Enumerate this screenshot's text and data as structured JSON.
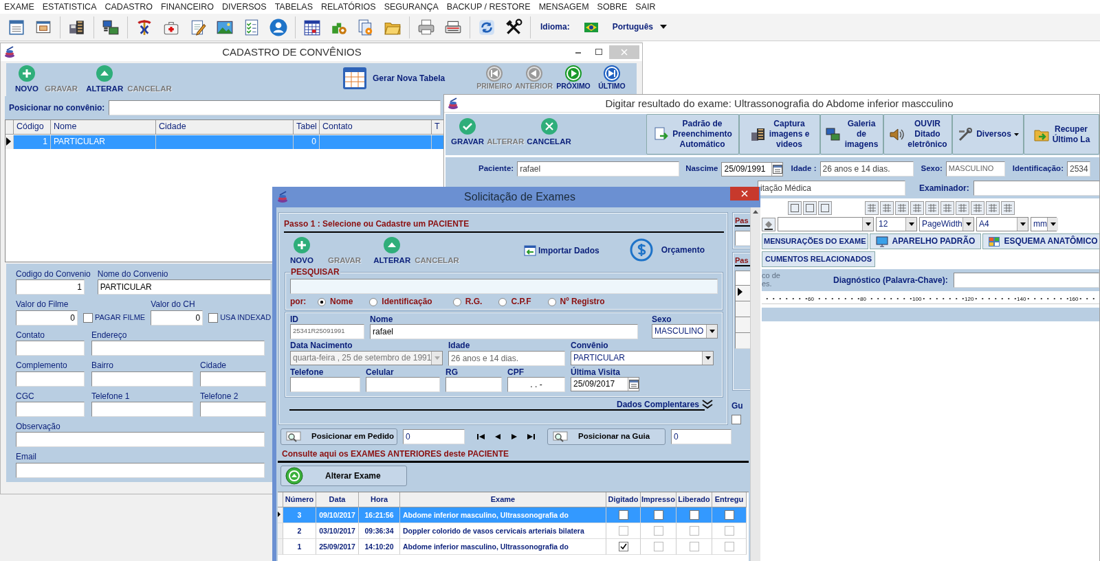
{
  "menu": [
    "EXAME",
    "ESTATISTICA",
    "CADASTRO",
    "FINANCEIRO",
    "DIVERSOS",
    "TABELAS",
    "RELATÓRIOS",
    "SEGURANÇA",
    "BACKUP / RESTORE",
    "MENSAGEM",
    "SOBRE",
    "SAIR"
  ],
  "toolbar": {
    "language_label": "Idioma:",
    "language": "Português"
  },
  "convenios_window": {
    "title": "CADASTRO DE CONVÊNIOS",
    "actions": [
      {
        "kind": "new",
        "label": "NOVO",
        "disabled": false
      },
      {
        "kind": "save",
        "label": "GRAVAR",
        "disabled": true
      },
      {
        "kind": "edit",
        "label": "ALTERAR",
        "disabled": false
      },
      {
        "kind": "cancel",
        "label": "CANCELAR",
        "disabled": true
      }
    ],
    "generate_button": "Gerar Nova Tabela",
    "navigation": [
      {
        "kind": "first",
        "label": "PRIMEIRO",
        "disabled": true
      },
      {
        "kind": "prev",
        "label": "ANTERIOR",
        "disabled": true
      },
      {
        "kind": "next",
        "label": "PRÓXIMO",
        "disabled": false
      },
      {
        "kind": "last",
        "label": "ÚLTIMO",
        "disabled": false
      }
    ],
    "locate_label": "Posicionar no convênio:",
    "table": {
      "columns": [
        "Código",
        "Nome",
        "Cidade",
        "Tabel",
        "Contato",
        "T"
      ],
      "rows": [
        {
          "code": "1",
          "name": "PARTICULAR",
          "table": "0",
          "selected": true
        }
      ]
    },
    "form_rows": [
      [
        {
          "kind": "number",
          "label": "Codigo do Convenio",
          "value": "1"
        },
        {
          "kind": "text",
          "label": "Nome do Convenio",
          "value": "PARTICULAR"
        }
      ],
      [
        {
          "kind": "number",
          "label": "Valor do Filme",
          "value": "0"
        },
        {
          "kind": "checkbox",
          "label": "PAGAR FILME",
          "checked": false
        },
        {
          "kind": "number",
          "label": "Valor do CH",
          "value": "0"
        },
        {
          "kind": "checkbox",
          "label": "USA INDEXAD",
          "checked": false
        }
      ],
      [
        {
          "kind": "text",
          "label": "Contato"
        },
        {
          "kind": "text",
          "label": "Endereço"
        }
      ],
      [
        {
          "kind": "text",
          "label": "Complemento"
        },
        {
          "kind": "text",
          "label": "Bairro"
        },
        {
          "kind": "text",
          "label": "Cidade"
        }
      ],
      [
        {
          "kind": "text",
          "label": "CGC"
        },
        {
          "kind": "text",
          "label": "Telefone 1"
        },
        {
          "kind": "text",
          "label": "Telefone 2"
        }
      ],
      [
        {
          "kind": "text",
          "label": "Observação"
        }
      ],
      [
        {
          "kind": "text",
          "label": "Email"
        }
      ]
    ]
  },
  "result_window": {
    "title": "Digitar resultado do exame: Ultrassonografia do Abdome inferior mascculino",
    "actions": [
      {
        "kind": "save",
        "label": "GRAVAR",
        "disabled": false
      },
      {
        "kind": "edit",
        "label": "ALTERAR",
        "disabled": true
      },
      {
        "kind": "cancel",
        "label": "CANCELAR",
        "disabled": false
      }
    ],
    "tool_buttons": [
      {
        "kind": "template",
        "lines": [
          "Padrão de",
          "Preenchimento",
          "Automático"
        ]
      },
      {
        "kind": "capture",
        "lines": [
          "Captura",
          "imagens e",
          "videos"
        ]
      },
      {
        "kind": "gallery",
        "lines": [
          "Galeria de",
          "imagens"
        ]
      },
      {
        "kind": "dictation",
        "lines": [
          "OUVIR Ditado",
          "eletrônico"
        ]
      },
      {
        "kind": "misc",
        "lines": [
          "Diversos"
        ]
      },
      {
        "kind": "recover",
        "lines": [
          "Recuper",
          "Último La"
        ]
      }
    ],
    "patient_fields": [
      {
        "kind": "text",
        "label": "Paciente:",
        "value": "rafael"
      },
      {
        "kind": "date",
        "label": "Nascime",
        "value": "25/09/1991"
      },
      {
        "kind": "text",
        "label": "Idade :",
        "value": "26 anos e 14 dias."
      },
      {
        "kind": "readonly",
        "label": "Sexo:",
        "value": "MASCULINO"
      },
      {
        "kind": "text",
        "label": "Identificação:",
        "value": "2534"
      }
    ],
    "requester_value": "itação Médica",
    "examiner_label": "Examinador:",
    "format_selects": [
      "12",
      "PageWidth",
      "A4",
      "mm"
    ],
    "tabs": [
      {
        "kind": "measurements",
        "label": "MENSURAÇÕES DO EXAME"
      },
      {
        "kind": "device",
        "label": "APARELHO PADRÃO"
      },
      {
        "kind": "anatomy",
        "label": "ESQUEMA ANATÔMICO"
      }
    ],
    "tabs_second_row": [
      "CUMENTOS RELACIONADOS"
    ],
    "faded_note_lines": [
      "co de",
      "es."
    ],
    "diagnosis_label": "Diagnóstico (Palavra-Chave):",
    "ruler_labels": [
      "60",
      "80",
      "100",
      "120",
      "140",
      "160"
    ]
  },
  "request_window": {
    "title": "Solicitação de Exames",
    "step_title": "Passo 1 : Selecione ou Cadastre um PACIENTE",
    "actions": [
      {
        "kind": "new",
        "label": "NOVO",
        "disabled": false
      },
      {
        "kind": "save",
        "label": "GRAVAR",
        "disabled": true
      },
      {
        "kind": "edit",
        "label": "ALTERAR",
        "disabled": false
      },
      {
        "kind": "cancel",
        "label": "CANCELAR",
        "disabled": true
      }
    ],
    "import_button": "Importar Dados",
    "budget_button": "Orçamento",
    "search_legend": "PESQUISAR",
    "search_by_label": "por:",
    "search_options": [
      {
        "label": "Nome",
        "selected": true
      },
      {
        "label": "Identificação",
        "selected": false
      },
      {
        "label": "R.G.",
        "selected": false
      },
      {
        "label": "C.P.F",
        "selected": false
      },
      {
        "label": "Nº Registro",
        "selected": false
      }
    ],
    "patient_rows": [
      [
        {
          "kind": "readonly",
          "label": "ID",
          "value": "25341R25091991"
        },
        {
          "kind": "text",
          "label": "Nome",
          "value": "rafael"
        },
        {
          "kind": "select",
          "label": "Sexo",
          "value": "MASCULINO"
        }
      ],
      [
        {
          "kind": "disabled_select",
          "label": "Data Nacimento",
          "value": "quarta-feira , 25 de setembro de 1991"
        },
        {
          "kind": "readonly",
          "label": "Idade",
          "value": "26 anos e 14 dias."
        },
        {
          "kind": "select",
          "label": "Convênio",
          "value": "PARTICULAR"
        }
      ],
      [
        {
          "kind": "text",
          "label": "Telefone"
        },
        {
          "kind": "text",
          "label": "Celular"
        },
        {
          "kind": "text",
          "label": "RG"
        },
        {
          "kind": "text",
          "label": "CPF",
          "value": ".  .  -"
        },
        {
          "kind": "date",
          "label": "Última Visita",
          "value": "25/09/2017"
        }
      ]
    ],
    "more_label": "Dados Complentares",
    "locate_order": {
      "label": "Posicionar em Pedido",
      "value": "0"
    },
    "locate_guide": {
      "label": "Posicionar na Guia",
      "value": "0"
    },
    "history_title": "Consulte aqui os EXAMES ANTERIORES deste PACIENTE",
    "edit_exam_button": "Alterar Exame",
    "history": {
      "columns": [
        "Número",
        "Data",
        "Hora",
        "Exame",
        "Digitado",
        "Impresso",
        "Liberado",
        "Entregu"
      ],
      "rows": [
        {
          "number": "3",
          "date": "09/10/2017",
          "time": "16:21:56",
          "exam": "Abdome inferior masculino, Ultrassonografia do",
          "typed": false,
          "printed": false,
          "released": false,
          "delivered": false,
          "selected": true
        },
        {
          "number": "2",
          "date": "03/10/2017",
          "time": "09:36:34",
          "exam": "Doppler colorido de vasos cervicais arteriais bilatera",
          "typed": false,
          "printed": false,
          "released": false,
          "delivered": false,
          "selected": false
        },
        {
          "number": "1",
          "date": "25/09/2017",
          "time": "14:10:20",
          "exam": "Abdome inferior masculino, Ultrassonografia do",
          "typed": true,
          "printed": false,
          "released": false,
          "delivered": false,
          "selected": false
        }
      ]
    },
    "side_strip": {
      "group_titles": [
        "Pas",
        "Pas"
      ],
      "footer_label": "Gu",
      "footer_checked": false
    }
  }
}
